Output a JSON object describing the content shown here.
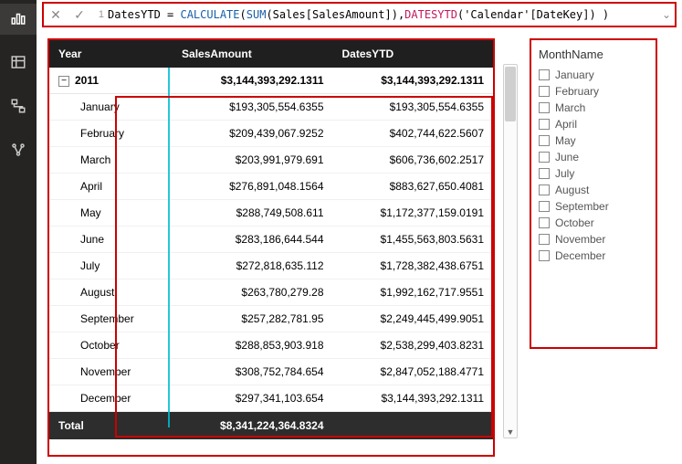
{
  "formula": {
    "line_no": "1",
    "measure_name": "DatesYTD",
    "eq": " = ",
    "fn_calc": "CALCULATE",
    "open1": "(",
    "fn_sum": "SUM",
    "sum_arg": "(Sales[SalesAmount])",
    "comma": ",",
    "fn_dytd": "DATESYTD",
    "dytd_arg": "('Calendar'[DateKey])",
    "close": " )"
  },
  "table": {
    "headers": {
      "year": "Year",
      "sales": "SalesAmount",
      "ytd": "DatesYTD"
    },
    "year_row": {
      "year": "2011",
      "sales": "$3,144,393,292.1311",
      "ytd": "$3,144,393,292.1311"
    },
    "rows": [
      {
        "m": "January",
        "s": "$193,305,554.6355",
        "y": "$193,305,554.6355"
      },
      {
        "m": "February",
        "s": "$209,439,067.9252",
        "y": "$402,744,622.5607"
      },
      {
        "m": "March",
        "s": "$203,991,979.691",
        "y": "$606,736,602.2517"
      },
      {
        "m": "April",
        "s": "$276,891,048.1564",
        "y": "$883,627,650.4081"
      },
      {
        "m": "May",
        "s": "$288,749,508.611",
        "y": "$1,172,377,159.0191"
      },
      {
        "m": "June",
        "s": "$283,186,644.544",
        "y": "$1,455,563,803.5631"
      },
      {
        "m": "July",
        "s": "$272,818,635.112",
        "y": "$1,728,382,438.6751"
      },
      {
        "m": "August",
        "s": "$263,780,279.28",
        "y": "$1,992,162,717.9551"
      },
      {
        "m": "September",
        "s": "$257,282,781.95",
        "y": "$2,249,445,499.9051"
      },
      {
        "m": "October",
        "s": "$288,853,903.918",
        "y": "$2,538,299,403.8231"
      },
      {
        "m": "November",
        "s": "$308,752,784.654",
        "y": "$2,847,052,188.4771"
      },
      {
        "m": "December",
        "s": "$297,341,103.654",
        "y": "$3,144,393,292.1311"
      }
    ],
    "total": {
      "label": "Total",
      "sales": "$8,341,224,364.8324",
      "ytd": ""
    }
  },
  "slicer": {
    "title": "MonthName",
    "items": [
      "January",
      "February",
      "March",
      "April",
      "May",
      "June",
      "July",
      "August",
      "September",
      "October",
      "November",
      "December"
    ]
  },
  "chart_data": {
    "type": "table",
    "title": "SalesAmount vs DatesYTD by Month (2011)",
    "columns": [
      "Month",
      "SalesAmount",
      "DatesYTD"
    ],
    "rows": [
      [
        "January",
        193305554.6355,
        193305554.6355
      ],
      [
        "February",
        209439067.9252,
        402744622.5607
      ],
      [
        "March",
        203991979.691,
        606736602.2517
      ],
      [
        "April",
        276891048.1564,
        883627650.4081
      ],
      [
        "May",
        288749508.611,
        1172377159.0191
      ],
      [
        "June",
        283186644.544,
        1455563803.5631
      ],
      [
        "July",
        272818635.112,
        1728382438.6751
      ],
      [
        "August",
        263780279.28,
        1992162717.9551
      ],
      [
        "September",
        257282781.95,
        2249445499.9051
      ],
      [
        "October",
        288853903.918,
        2538299403.8231
      ],
      [
        "November",
        308752784.654,
        2847052188.4771
      ],
      [
        "December",
        297341103.654,
        3144393292.1311
      ]
    ],
    "year_total_sales": 8341224364.8324
  }
}
